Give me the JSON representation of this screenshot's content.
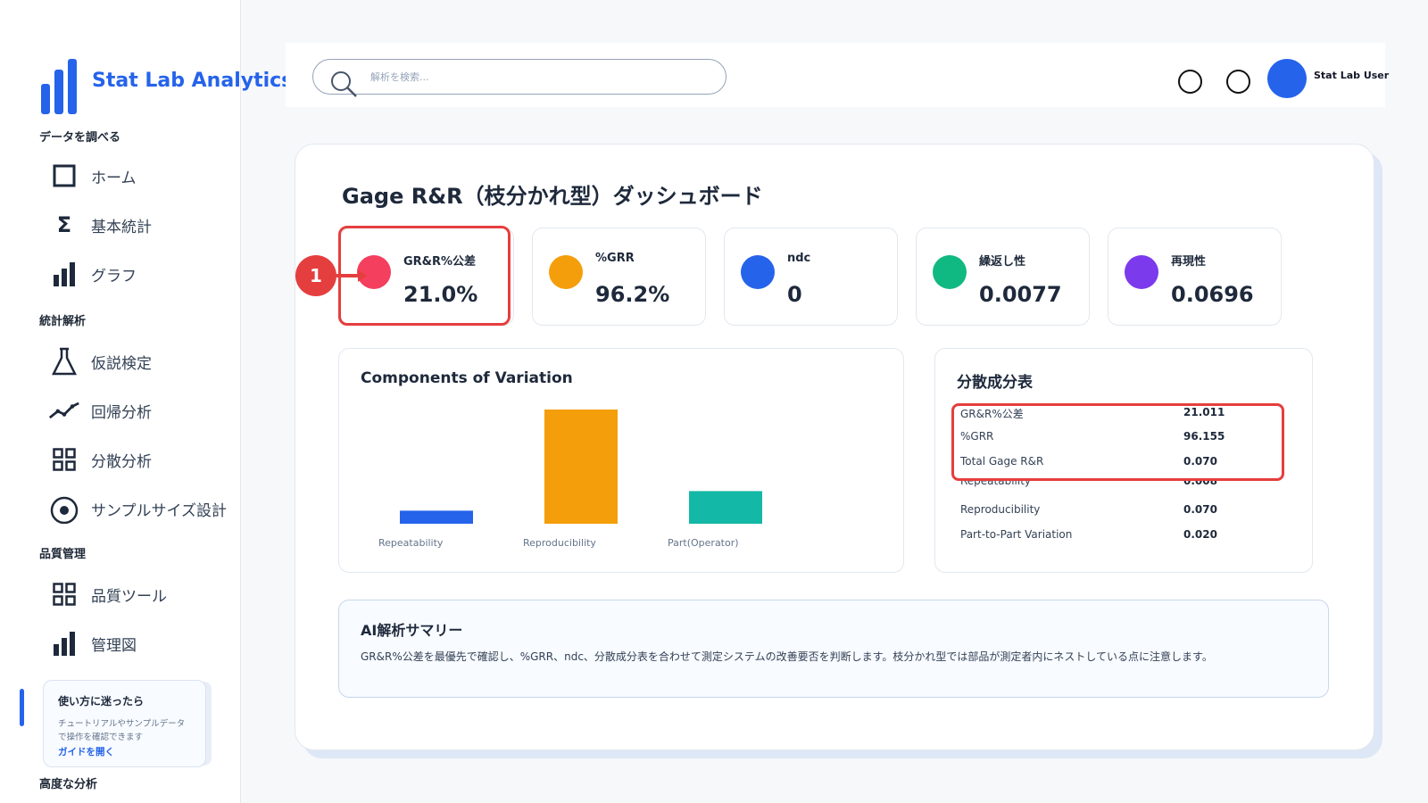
{
  "app": {
    "name": "Stat Lab Analytics"
  },
  "sidebar": {
    "sections": [
      {
        "title": "データを調べる"
      },
      {
        "title": "統計解析"
      },
      {
        "title": "品質管理"
      },
      {
        "title": "高度な分析"
      }
    ],
    "items": [
      {
        "label": "ホーム",
        "icon": "square-icon"
      },
      {
        "label": "基本統計",
        "icon": "sigma-icon"
      },
      {
        "label": "グラフ",
        "icon": "bar-chart-icon"
      },
      {
        "label": "仮説検定",
        "icon": "flask-icon"
      },
      {
        "label": "回帰分析",
        "icon": "trend-line-icon"
      },
      {
        "label": "分散分析",
        "icon": "grid-icon"
      },
      {
        "label": "サンプルサイズ設計",
        "icon": "target-icon"
      },
      {
        "label": "品質ツール",
        "icon": "grid-icon"
      },
      {
        "label": "管理図",
        "icon": "bar-chart-icon"
      }
    ],
    "help": {
      "title": "使い方に迷ったら",
      "description": "チュートリアルやサンプルデータで操作を確認できます",
      "link": "ガイドを開く"
    }
  },
  "header": {
    "search_placeholder": "解析を検索...",
    "user_name": "Stat Lab User"
  },
  "dashboard": {
    "title": "Gage R&R（枝分かれ型）ダッシュボード",
    "annotation_number": "1",
    "kpis": [
      {
        "label": "GR&R%公差",
        "value": "21.0%",
        "color": "#f43f5e"
      },
      {
        "label": "%GRR",
        "value": "96.2%",
        "color": "#f59e0b"
      },
      {
        "label": "ndc",
        "value": "0",
        "color": "#2563eb"
      },
      {
        "label": "繰返し性",
        "value": "0.0077",
        "color": "#10b981"
      },
      {
        "label": "再現性",
        "value": "0.0696",
        "color": "#7c3aed"
      }
    ],
    "variance_table": {
      "title": "分散成分表",
      "rows": [
        {
          "name": "GR&R%公差",
          "value": "21.011"
        },
        {
          "name": "%GRR",
          "value": "96.155"
        },
        {
          "name": "Total Gage R&R",
          "value": "0.070"
        },
        {
          "name": "Repeatability",
          "value": "0.008"
        },
        {
          "name": "Reproducibility",
          "value": "0.070"
        },
        {
          "name": "Part-to-Part Variation",
          "value": "0.020"
        }
      ]
    },
    "summary": {
      "title": "AI解析サマリー",
      "text": "GR&R%公差を最優先で確認し、%GRR、ndc、分散成分表を合わせて測定システムの改善要否を判断します。枝分かれ型では部品が測定者内にネストしている点に注意します。"
    }
  },
  "chart_data": {
    "type": "bar",
    "title": "Components of Variation",
    "categories": [
      "Repeatability",
      "Reproducibility",
      "Part(Operator)"
    ],
    "values": [
      0.008,
      0.07,
      0.02
    ],
    "colors": [
      "#2563eb",
      "#f59e0b",
      "#14b8a6"
    ],
    "ylim": [
      0,
      0.07
    ],
    "grid": false,
    "legend": "none"
  }
}
